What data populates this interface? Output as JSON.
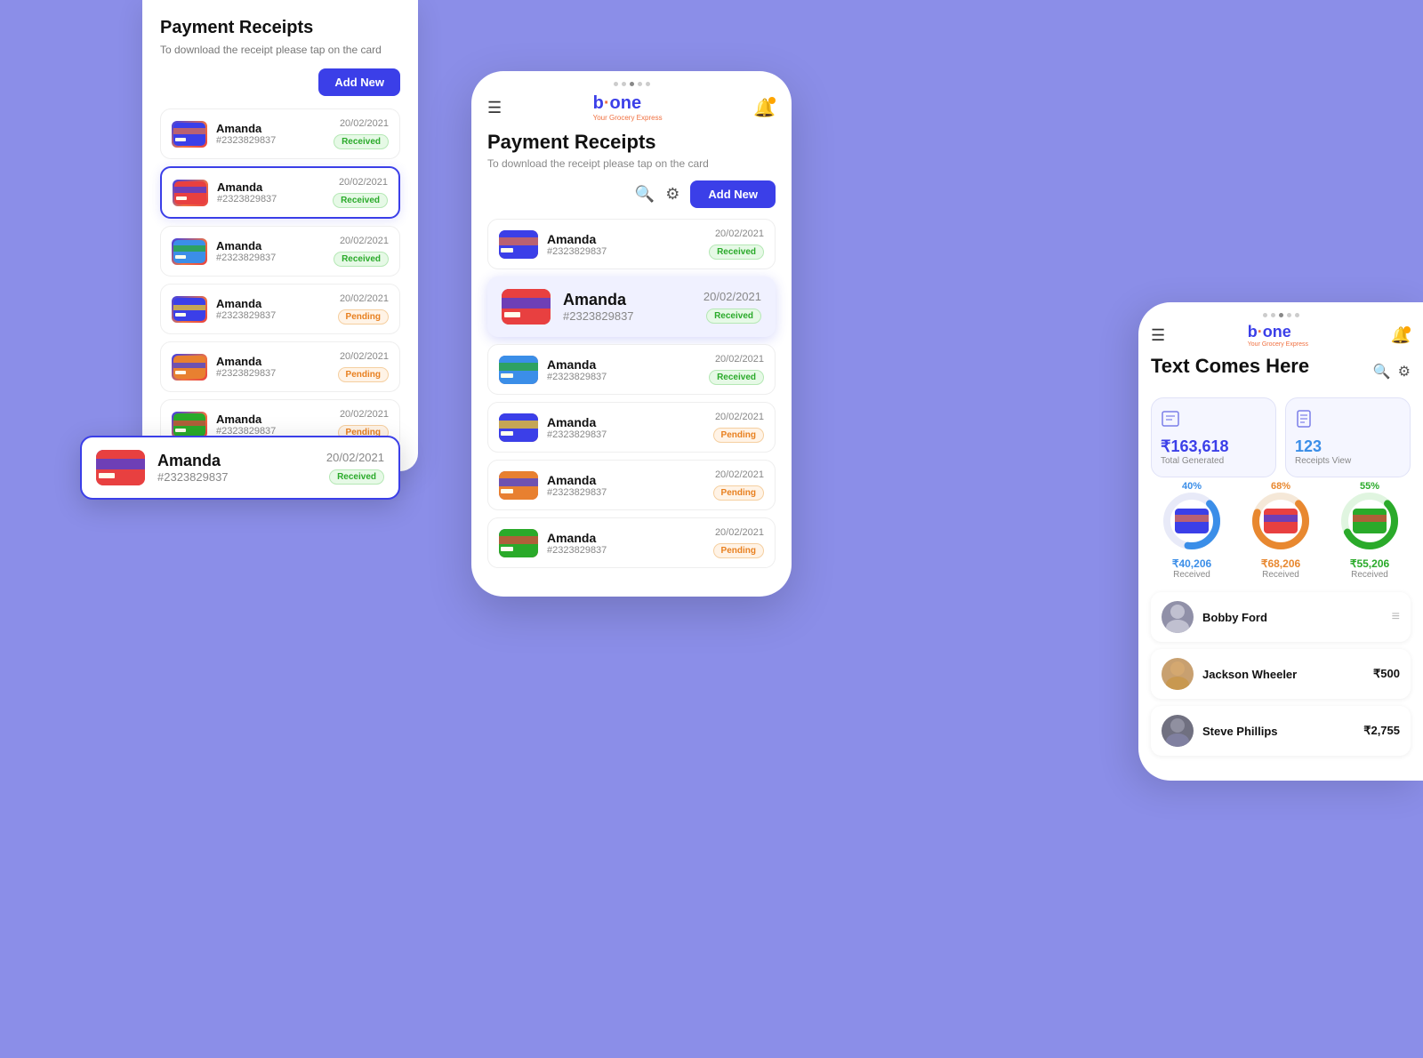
{
  "bg": "#8b8ee8",
  "left_panel": {
    "title": "Payment Receipts",
    "subtitle": "To download the receipt please tap on the card",
    "add_button": "Add New",
    "cards": [
      {
        "name": "Amanda",
        "id": "#2323829837",
        "date": "20/02/2021",
        "status": "Received",
        "selected": false
      },
      {
        "name": "Amanda",
        "id": "#2323829837",
        "date": "20/02/2021",
        "status": "Received",
        "selected": true
      },
      {
        "name": "Amanda",
        "id": "#2323829837",
        "date": "20/02/2021",
        "status": "Received",
        "selected": false
      },
      {
        "name": "Amanda",
        "id": "#2323829837",
        "date": "20/02/2021",
        "status": "Pending",
        "selected": false
      },
      {
        "name": "Amanda",
        "id": "#2323829837",
        "date": "20/02/2021",
        "status": "Pending",
        "selected": false
      },
      {
        "name": "Amanda",
        "id": "#2323829837",
        "date": "20/02/2021",
        "status": "Pending",
        "selected": false
      }
    ]
  },
  "floating_card": {
    "name": "Amanda",
    "id": "#2323829837",
    "date": "20/02/2021",
    "status": "Received"
  },
  "center_phone": {
    "logo": "bione",
    "page_title": "Payment Receipts",
    "page_subtitle": "To download the receipt please tap on the card",
    "add_button": "Add New",
    "cards": [
      {
        "name": "Amanda",
        "id": "#2323829837",
        "date": "20/02/2021",
        "status": "Received",
        "selected": false
      },
      {
        "name": "Amanda",
        "id": "#2323829837",
        "date": "20/02/2021",
        "status": "Received",
        "selected": true
      },
      {
        "name": "Amanda",
        "id": "#2323829837",
        "date": "20/02/2021",
        "status": "Received",
        "selected": false
      },
      {
        "name": "Amanda",
        "id": "#2323829837",
        "date": "20/02/2021",
        "status": "Pending",
        "selected": false
      },
      {
        "name": "Amanda",
        "id": "#2323829837",
        "date": "20/02/2021",
        "status": "Pending",
        "selected": false
      },
      {
        "name": "Amanda",
        "id": "#2323829837",
        "date": "20/02/2021",
        "status": "Pending",
        "selected": false
      }
    ]
  },
  "right_phone": {
    "logo": "bione",
    "page_title": "Text Comes Here",
    "stats": [
      {
        "icon": "₹",
        "value": "₹163,618",
        "label": "Total Generated"
      },
      {
        "icon": "📄",
        "value": "123",
        "label": "Receipts View"
      }
    ],
    "donuts": [
      {
        "pct": 40,
        "color": "#3b8ee8",
        "amount": "₹40,206",
        "label": "Received"
      },
      {
        "pct": 68,
        "color": "#e88830",
        "amount": "₹68,206",
        "label": "Received"
      },
      {
        "pct": 55,
        "color": "#2aaa2a",
        "amount": "₹55,206",
        "label": "Received"
      }
    ],
    "persons": [
      {
        "name": "Bobby Ford",
        "amount": "",
        "avatar_color": "#a0a0b0"
      },
      {
        "name": "Jackson Wheeler",
        "amount": "₹500",
        "avatar_color": "#c0a080"
      },
      {
        "name": "Steve Phillips",
        "amount": "₹2,755",
        "avatar_color": "#808090"
      }
    ]
  }
}
